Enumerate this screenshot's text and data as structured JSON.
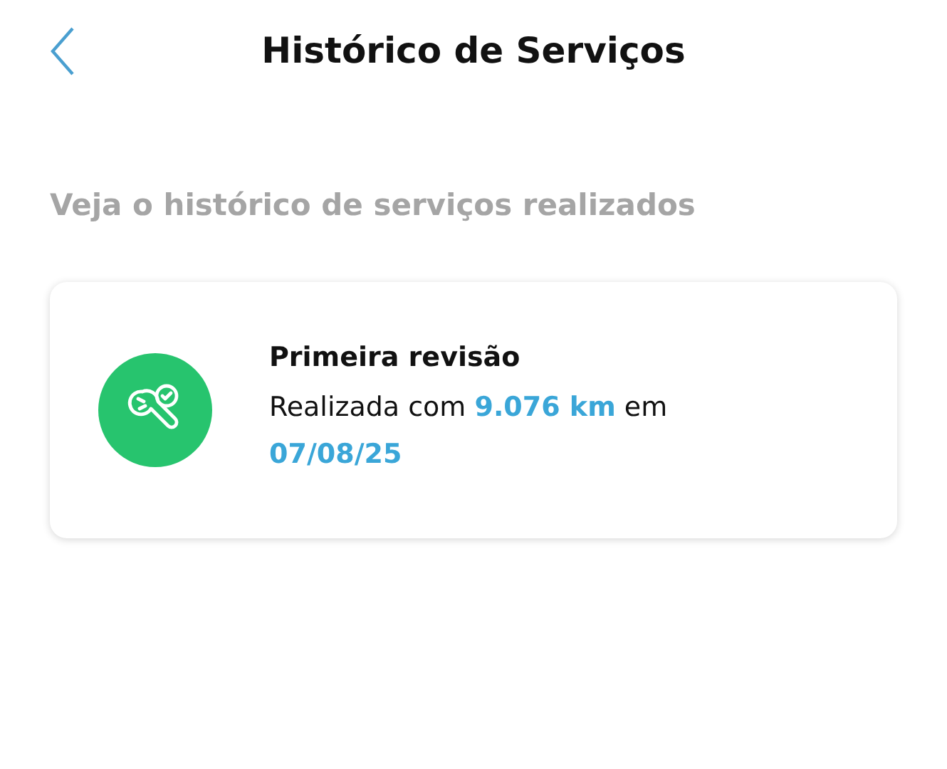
{
  "header": {
    "title": "Histórico de Serviços"
  },
  "subtitle": "Veja o histórico de serviços realizados",
  "services": [
    {
      "title": "Primeira revisão",
      "description": "Realizada com **9.076 km** em **07/08/25**"
    }
  ]
}
